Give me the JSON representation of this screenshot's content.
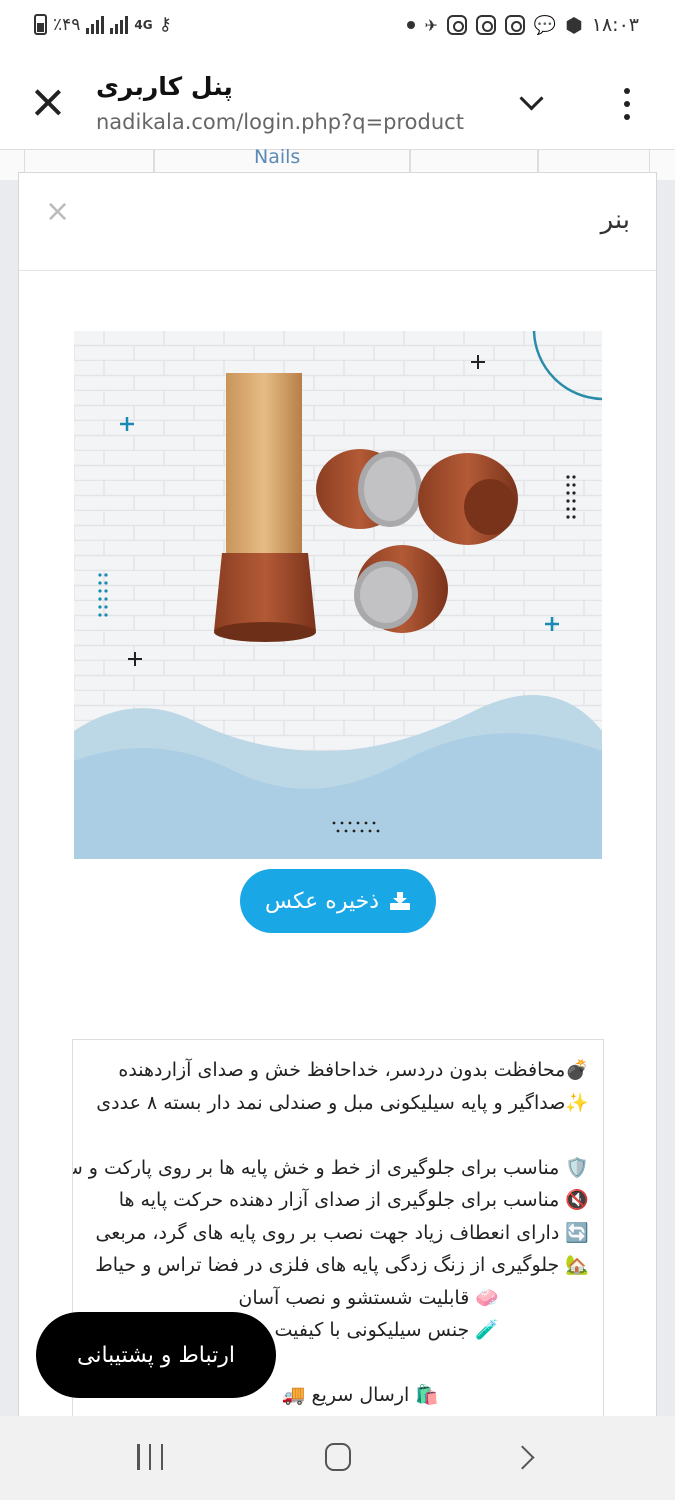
{
  "status_bar": {
    "time": "۱۸:۰۳",
    "battery": "٪۴۹",
    "network": "4G"
  },
  "browser": {
    "title": "پنل کاربری",
    "url": "nadikala.com/login.php?q=product"
  },
  "background_page": {
    "fragment_text": "Nails"
  },
  "modal": {
    "title": "بنر",
    "close_label": "×",
    "banner_alt": "silicone chair leg caps",
    "save_button": "ذخیره عکس",
    "description_lines": [
      "💣محافظت بدون دردسر، خداحافظ خش و صدای آزاردهنده",
      "✨صداگیر و پایه سیلیکونی مبل و صندلی نمد دار بسته ۸ عددی",
      "",
      "🛡️ مناسب برای جلوگیری از خط و خش پایه ها بر روی پارکت و سرامیک",
      "🔇 مناسب برای جلوگیری از صدای آزار دهنده حرکت پایه ها",
      "🔄 دارای انعطاف زیاد جهت نصب بر روی پایه های گرد، مربعی",
      "🏡 جلوگیری از زنگ زدگی پایه های فلزی در فضا تراس و حیاط",
      "🧼 قابلیت شستشو و نصب آسان",
      "🧪 جنس سیلیکونی با کیفیت",
      "",
      "🛍️ ارسال سریع 🚚"
    ]
  },
  "support_button": "ارتباط و پشتیبانی",
  "colors": {
    "accent": "#19a7e6",
    "support_bg": "#000000"
  }
}
